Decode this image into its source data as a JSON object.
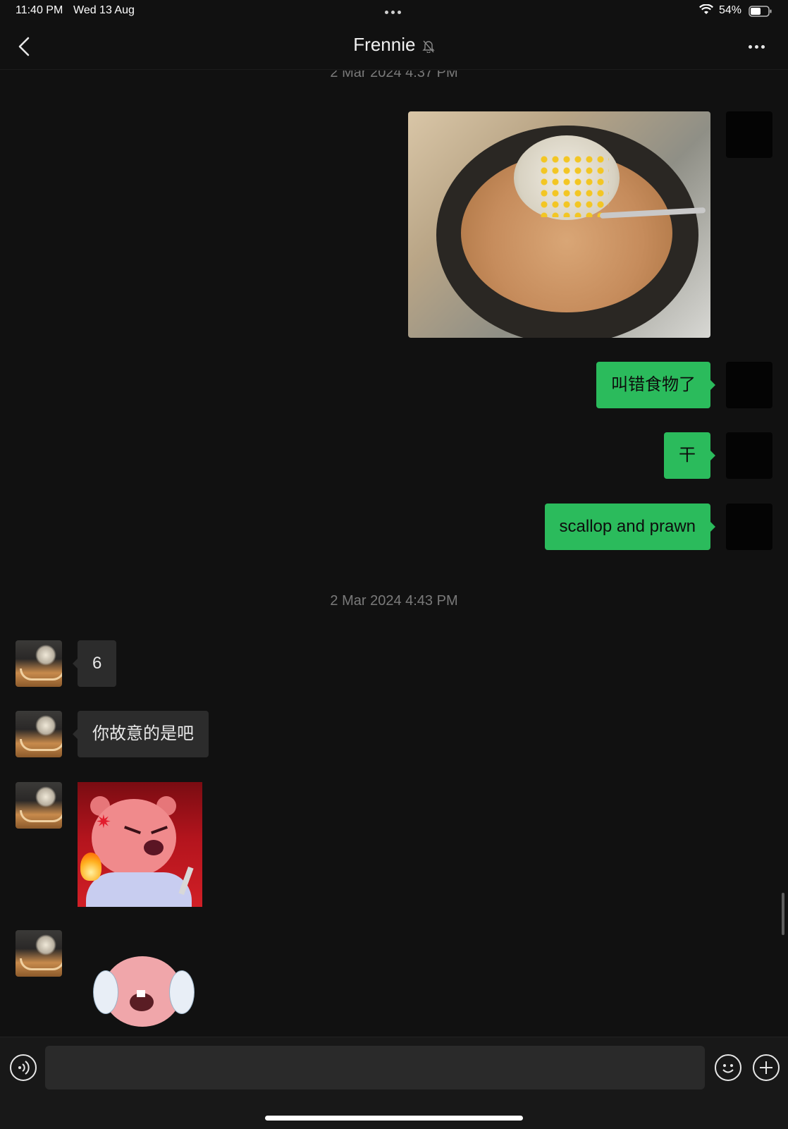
{
  "status_bar": {
    "time": "11:40 PM",
    "date": "Wed 13 Aug",
    "battery_percent": "54%"
  },
  "header": {
    "title": "Frennie",
    "muted": true
  },
  "timestamps": [
    "2 Mar 2024 4:37 PM",
    "2 Mar 2024 4:43 PM"
  ],
  "messages": [
    {
      "sender": "me",
      "type": "image",
      "icon": "food-photo"
    },
    {
      "sender": "me",
      "type": "text",
      "text": "叫错食物了"
    },
    {
      "sender": "me",
      "type": "text",
      "text": "干"
    },
    {
      "sender": "me",
      "type": "text",
      "text": "scallop and prawn"
    },
    {
      "sender": "Frennie",
      "type": "text",
      "text": "6"
    },
    {
      "sender": "Frennie",
      "type": "text",
      "text": "你故意的是吧"
    },
    {
      "sender": "Frennie",
      "type": "sticker",
      "icon": "angry-beaver-sticker"
    },
    {
      "sender": "Frennie",
      "type": "sticker",
      "icon": "crying-beaver-sticker"
    }
  ],
  "input": {
    "placeholder": "",
    "value": ""
  },
  "colors": {
    "background": "#111111",
    "outgoing_bubble": "#2bbb5c",
    "incoming_bubble": "#2c2c2c",
    "timestamp": "#7a7a7a"
  }
}
